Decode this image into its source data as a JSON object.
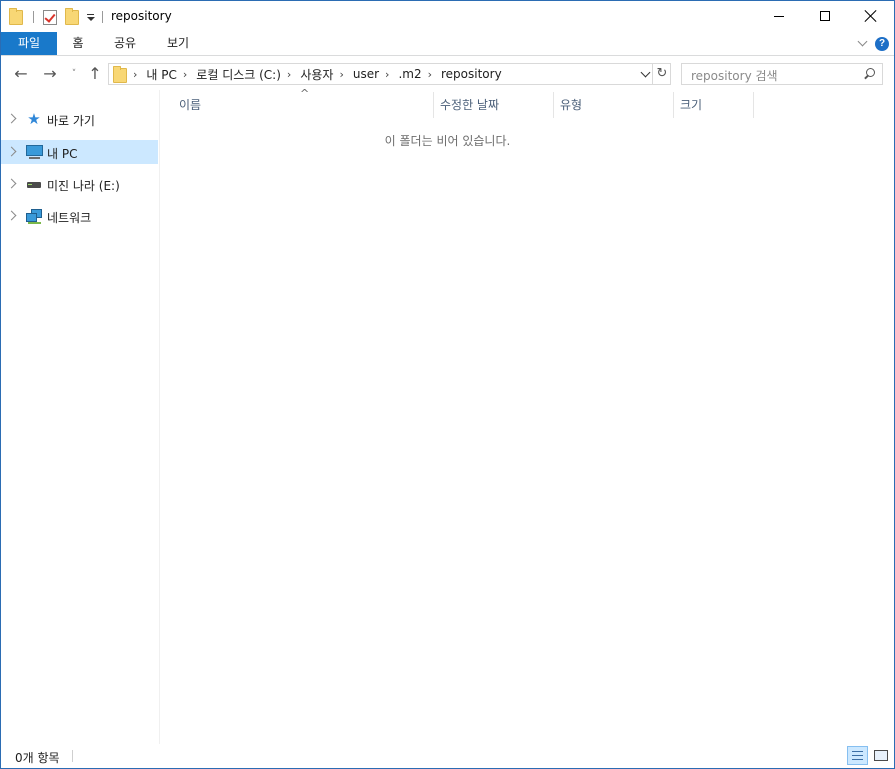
{
  "window": {
    "title": "repository"
  },
  "ribbon": {
    "tabs": [
      {
        "label": "파일"
      },
      {
        "label": "홈"
      },
      {
        "label": "공유"
      },
      {
        "label": "보기"
      }
    ],
    "help_label": "?"
  },
  "nav": {
    "back_glyph": "←",
    "forward_glyph": "→",
    "recent_glyph": "˅",
    "up_glyph": "↑",
    "refresh_glyph": "↻",
    "breadcrumbs": [
      "내 PC",
      "로컬 디스크 (C:)",
      "사용자",
      "user",
      ".m2",
      "repository"
    ],
    "search_placeholder": "repository 검색"
  },
  "sidebar": {
    "items": [
      {
        "label": "바로 가기",
        "icon": "star-icon"
      },
      {
        "label": "내 PC",
        "icon": "computer-icon",
        "selected": true
      },
      {
        "label": "미진 나라 (E:)",
        "icon": "drive-icon"
      },
      {
        "label": "네트워크",
        "icon": "network-icon"
      }
    ]
  },
  "columns": {
    "name": "이름",
    "modified": "수정한 날짜",
    "type": "유형",
    "size": "크기",
    "sort_glyph": "^"
  },
  "content": {
    "empty_message": "이 폴더는 비어 있습니다."
  },
  "status": {
    "item_count": "0개 항목"
  },
  "colors": {
    "accent": "#1979ca",
    "selection": "#cce8ff",
    "border": "#2b6cb3"
  }
}
